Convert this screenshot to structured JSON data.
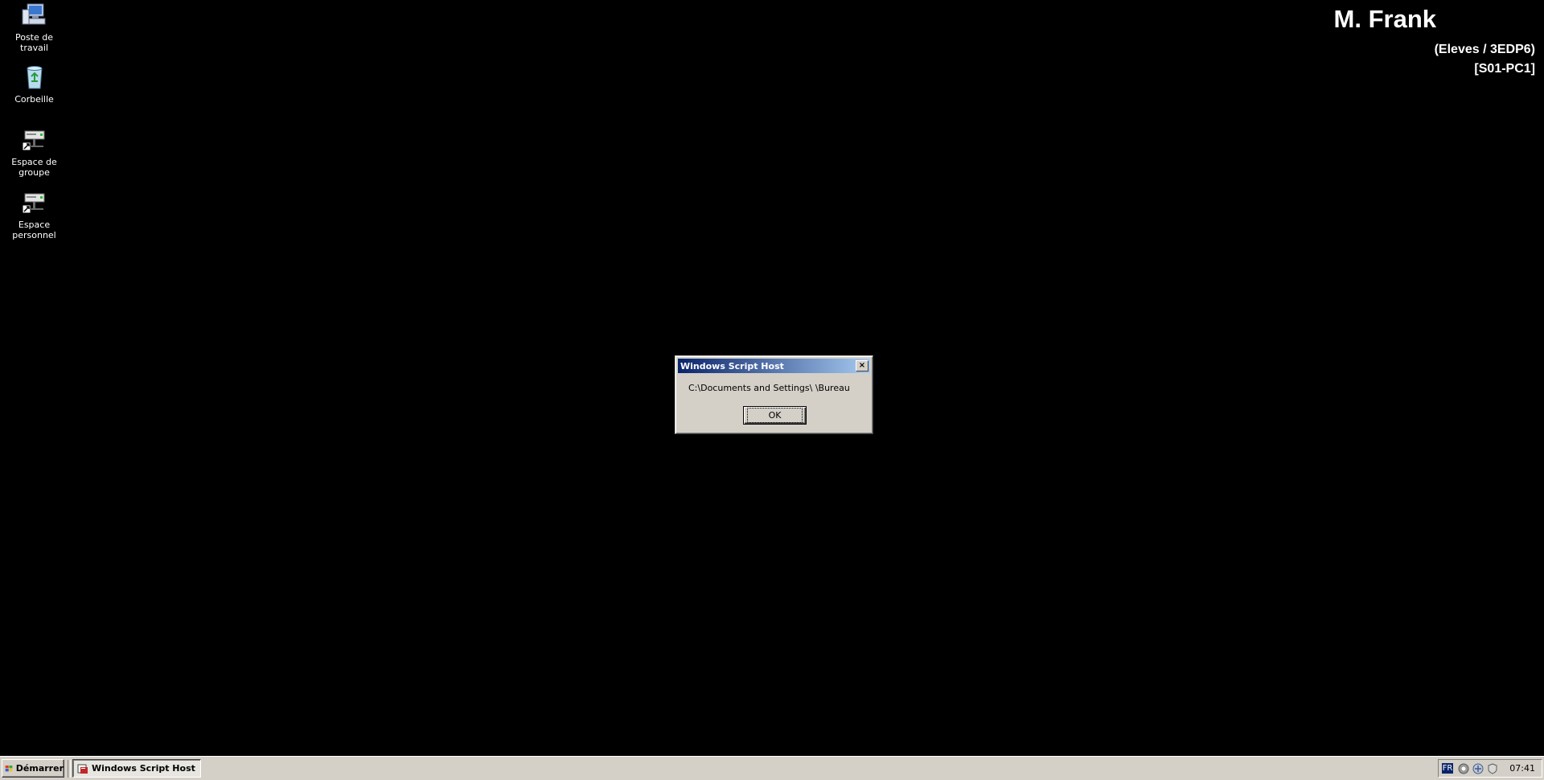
{
  "desktop": {
    "icons": [
      {
        "label": "Poste de travail",
        "icon": "my-computer-icon"
      },
      {
        "label": "Corbeille",
        "icon": "recycle-bin-icon"
      },
      {
        "label": "Espace de groupe",
        "icon": "network-drive-icon"
      },
      {
        "label": "Espace personnel",
        "icon": "network-drive-icon"
      }
    ],
    "background_color": "#000000"
  },
  "user_info": {
    "name": "M. Frank",
    "group": "(Eleves / 3EDP6)",
    "pc": "[S01-PC1]"
  },
  "dialog": {
    "title": "Windows Script Host",
    "message": "C:\\Documents and Settings\\ \\Bureau",
    "ok_label": "OK",
    "close_label": "×",
    "title_gradient": [
      "#0a246a",
      "#a6caf0"
    ]
  },
  "taskbar": {
    "start_label": "Démarrer",
    "task_label": "Windows Script Host",
    "lang": "FR",
    "clock": "07:41",
    "tray_icons": [
      "volume-icon",
      "network-icon",
      "security-icon"
    ]
  }
}
